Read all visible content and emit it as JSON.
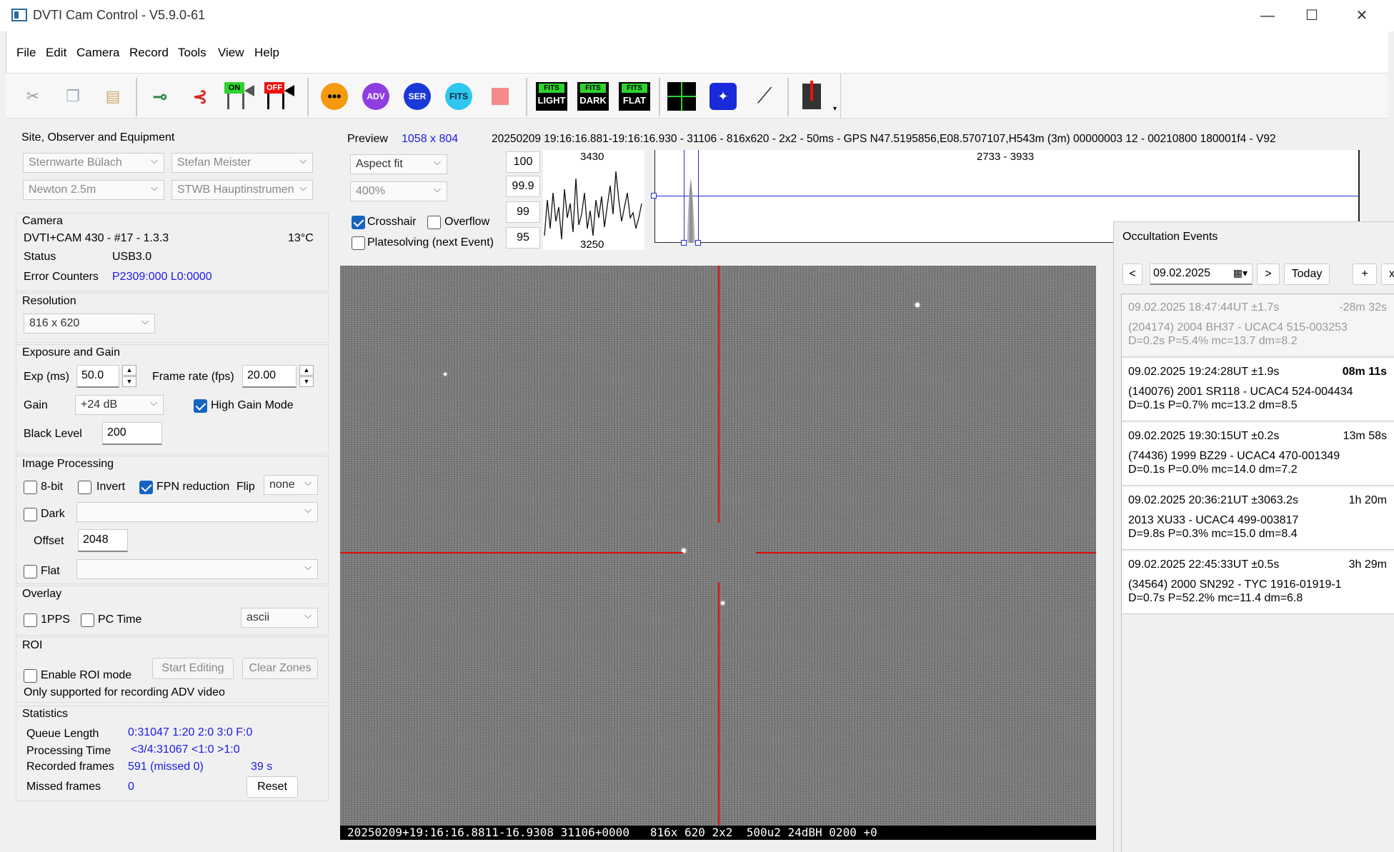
{
  "window": {
    "title": "DVTI Cam Control - V5.9.0-61"
  },
  "menu": [
    "File",
    "Edit",
    "Camera",
    "Record",
    "Tools",
    "View",
    "Help"
  ],
  "toolbar": {
    "adv": "ADV",
    "ser": "SER",
    "fits": "FITS",
    "fits_light_top": "FITS",
    "fits_light_bot": "LIGHT",
    "fits_dark_top": "FITS",
    "fits_dark_bot": "DARK",
    "fits_flat_top": "FITS",
    "fits_flat_bot": "FLAT",
    "on": "ON",
    "off": "OFF"
  },
  "site": {
    "title": "Site, Observer and Equipment",
    "site": "Sternwarte Bülach",
    "observer": "Stefan Meister",
    "telescope": "Newton 2.5m",
    "instrument": "STWB Hauptinstrumen"
  },
  "camera": {
    "title": "Camera",
    "model": "DVTI+CAM 430  -  #17  -  1.3.3",
    "temp": "13°C",
    "status_label": "Status",
    "status_value": "USB3.0",
    "err_label": "Error Counters",
    "err_value": "P2309:000 L0:0000"
  },
  "resolution": {
    "title": "Resolution",
    "value": "816 x 620"
  },
  "exposure": {
    "title": "Exposure and Gain",
    "exp_label": "Exp (ms)",
    "exp_value": "50.0",
    "fps_label": "Frame rate (fps)",
    "fps_value": "20.00",
    "gain_label": "Gain",
    "gain_value": "+24 dB",
    "high_gain": "High Gain Mode",
    "black_label": "Black Level",
    "black_value": "200"
  },
  "processing": {
    "title": "Image Processing",
    "bit8": "8-bit",
    "invert": "Invert",
    "fpn": "FPN reduction",
    "flip_label": "Flip",
    "flip_value": "none",
    "dark": "Dark",
    "offset_label": "Offset",
    "offset_value": "2048",
    "flat": "Flat"
  },
  "overlay": {
    "title": "Overlay",
    "pps": "1PPS",
    "pctime": "PC Time",
    "format": "ascii"
  },
  "roi": {
    "title": "ROI",
    "enable": "Enable ROI mode",
    "start": "Start Editing",
    "clear": "Clear Zones",
    "note": "Only supported for recording ADV video"
  },
  "stats": {
    "title": "Statistics",
    "queue_label": "Queue Length",
    "queue_value": "0:31047  1:20  2:0  3:0  F:0",
    "proc_label": "Processing Time",
    "proc_value": "<3/4:31067 <1:0  >1:0",
    "rec_label": "Recorded frames",
    "rec_value": "591 (missed 0)",
    "rec_time": "39 s",
    "missed_label": "Missed frames",
    "missed_value": "0",
    "reset": "Reset"
  },
  "preview": {
    "label": "Preview",
    "size": "1058 x 804",
    "info": "20250209 19:16:16.881-19:16:16.930 - 31106 - 816x620 - 2x2 - 50ms - GPS N47.5195856,E08.5707107,H543m (3m) 00000003 12 - 00210800 180001f4 - V92",
    "fit": "Aspect fit",
    "zoom": "400%",
    "crosshair": "Crosshair",
    "overflow": "Overflow",
    "platesolve": "Platesolving (next Event)",
    "levels": [
      "100",
      "99.9",
      "99",
      "95"
    ],
    "graph_top": "3430",
    "graph_bot": "3250",
    "hist_range": "2733 - 3933",
    "overlay_text": "20250209+19:16:16.8811-16.9308 31106+0000   816x 620 2x2  500u2 24dBH 0200 +0"
  },
  "occultation": {
    "title": "Occultation Events",
    "prev": "<",
    "next": ">",
    "date": "09.02.2025",
    "today": "Today",
    "add": "+",
    "close": "x",
    "events": [
      {
        "time": "09.02.2025 18:47:44UT ±1.7s",
        "rel": "-28m 32s",
        "obj": "(204174) 2004 BH37 - UCAC4 515-003253",
        "params": "D=0.2s   P=5.4%   mc=13.7   dm=8.2"
      },
      {
        "time": "09.02.2025 19:24:28UT ±1.9s",
        "rel": "08m 11s",
        "obj": "(140076) 2001 SR118 - UCAC4 524-004434",
        "params": "D=0.1s   P=0.7%   mc=13.2   dm=8.5"
      },
      {
        "time": "09.02.2025 19:30:15UT ±0.2s",
        "rel": "13m 58s",
        "obj": "(74436) 1999 BZ29 - UCAC4 470-001349",
        "params": "D=0.1s   P=0.0%   mc=14.0   dm=7.2"
      },
      {
        "time": "09.02.2025 20:36:21UT ±3063.2s",
        "rel": "1h 20m",
        "obj": "2013 XU33 - UCAC4 499-003817",
        "params": "D=9.8s   P=0.3%   mc=15.0   dm=8.4"
      },
      {
        "time": "09.02.2025 22:45:33UT ±0.5s",
        "rel": "3h 29m",
        "obj": "(34564) 2000 SN292 - TYC 1916-01919-1",
        "params": "D=0.7s   P=52.2%   mc=11.4   dm=6.8"
      }
    ]
  }
}
